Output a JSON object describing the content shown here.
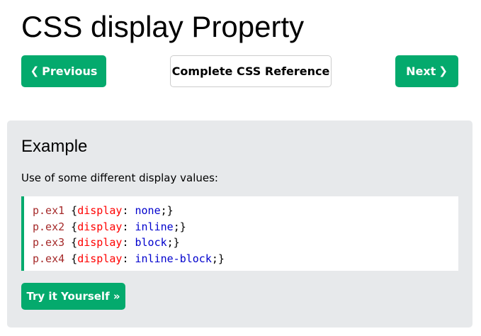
{
  "page": {
    "title": "CSS display Property"
  },
  "nav": {
    "previous_label": "Previous",
    "previous_icon": "chevron-left-icon",
    "reference_label": "Complete CSS Reference",
    "next_label": "Next",
    "next_icon": "chevron-right-icon"
  },
  "example": {
    "heading": "Example",
    "description": "Use of some different display values:",
    "code_lines": [
      {
        "selector": "p.ex1",
        "property": "display",
        "value": "none"
      },
      {
        "selector": "p.ex2",
        "property": "display",
        "value": "inline"
      },
      {
        "selector": "p.ex3",
        "property": "display",
        "value": "block"
      },
      {
        "selector": "p.ex4",
        "property": "display",
        "value": "inline-block"
      }
    ],
    "try_button_label": "Try it Yourself »"
  },
  "colors": {
    "accent_green": "#04aa6d",
    "example_bg": "#e7e9eb",
    "code_selector": "#a52a2a",
    "code_property": "#ff0000",
    "code_value": "#0000cd"
  }
}
